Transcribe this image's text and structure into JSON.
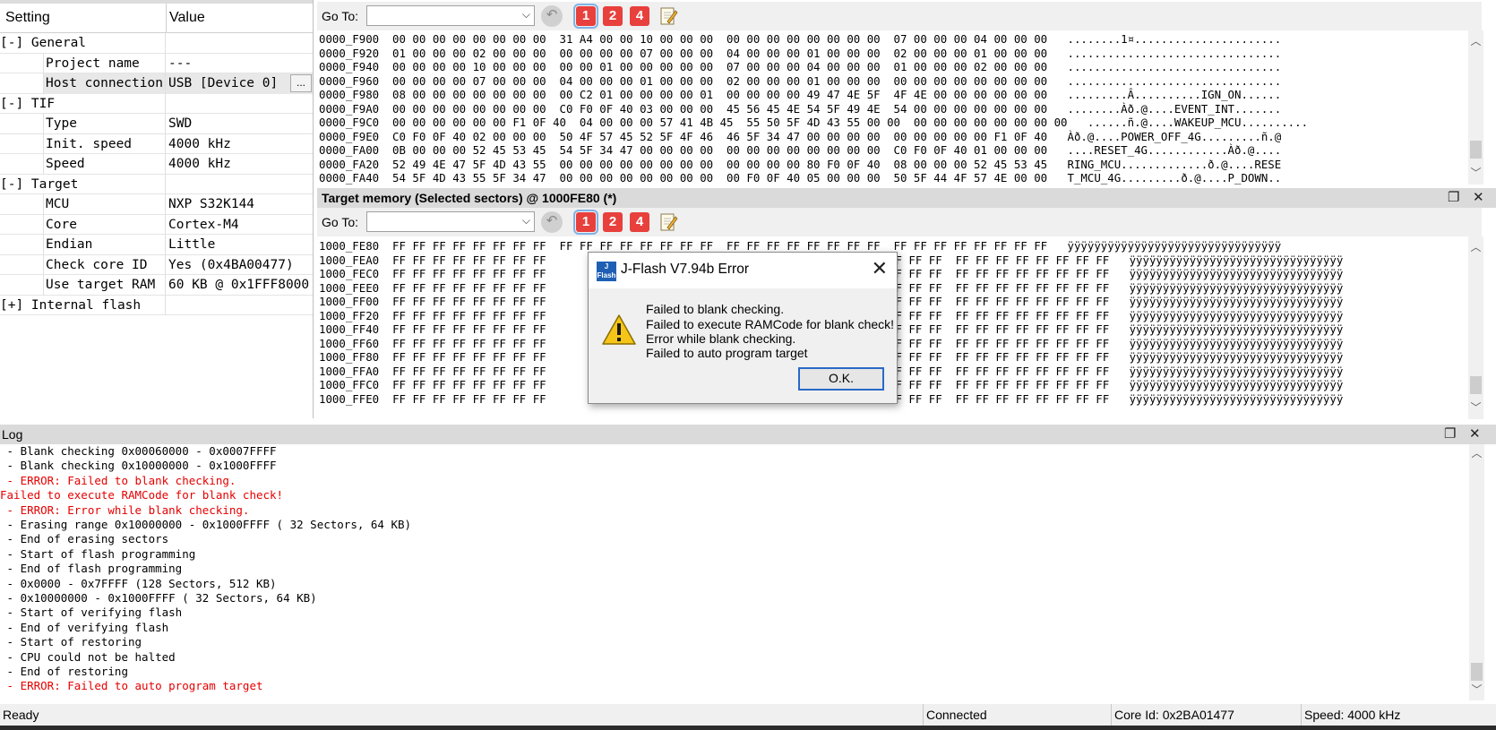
{
  "settings": {
    "header_setting": "Setting",
    "header_value": "Value",
    "rows": [
      {
        "setting": "[-] General",
        "value": ""
      },
      {
        "setting": "Project name",
        "value": "---"
      },
      {
        "setting": "Host connection",
        "value": "USB [Device 0]",
        "browse": "..."
      },
      {
        "setting": "[-] TIF",
        "value": ""
      },
      {
        "setting": "Type",
        "value": "SWD"
      },
      {
        "setting": "Init. speed",
        "value": "4000 kHz"
      },
      {
        "setting": "Speed",
        "value": "4000 kHz"
      },
      {
        "setting": "[-] Target",
        "value": ""
      },
      {
        "setting": "MCU",
        "value": "NXP S32K144"
      },
      {
        "setting": "Core",
        "value": "Cortex-M4"
      },
      {
        "setting": "Endian",
        "value": "Little"
      },
      {
        "setting": "Check core ID",
        "value": "Yes (0x4BA00477)"
      },
      {
        "setting": "Use target RAM",
        "value": "60 KB @ 0x1FFF8000"
      },
      {
        "setting": "[+] Internal flash",
        "value": ""
      }
    ]
  },
  "toolbar": {
    "goto_label": "Go To:",
    "buttons": [
      "1",
      "2",
      "4"
    ]
  },
  "hex_top": {
    "lines": [
      "0000_F900  00 00 00 00 00 00 00 00  31 A4 00 00 10 00 00 00  00 00 00 00 00 00 00 00  07 00 00 00 04 00 00 00   ........1¤......................",
      "0000_F920  01 00 00 00 02 00 00 00  00 00 00 00 07 00 00 00  04 00 00 00 01 00 00 00  02 00 00 00 01 00 00 00   ................................",
      "0000_F940  00 00 00 00 10 00 00 00  00 00 01 00 00 00 00 00  07 00 00 00 04 00 00 00  01 00 00 00 02 00 00 00   ................................",
      "0000_F960  00 00 00 00 07 00 00 00  04 00 00 00 01 00 00 00  02 00 00 00 01 00 00 00  00 00 00 00 00 00 00 00   ................................",
      "0000_F980  08 00 00 00 00 00 00 00  00 C2 01 00 00 00 00 01  00 00 00 00 49 47 4E 5F  4F 4E 00 00 00 00 00 00   .........Â..........IGN_ON......",
      "0000_F9A0  00 00 00 00 00 00 00 00  C0 F0 0F 40 03 00 00 00  45 56 45 4E 54 5F 49 4E  54 00 00 00 00 00 00 00   ........Àð.@....EVENT_INT.......",
      "0000_F9C0  00 00 00 00 00 00 F1 0F 40  04 00 00 00 57 41 4B 45  55 50 5F 4D 43 55 00 00  00 00 00 00 00 00 00 00   ......ñ.@....WAKEUP_MCU..........",
      "0000_F9E0  C0 F0 0F 40 02 00 00 00  50 4F 57 45 52 5F 4F 46  46 5F 34 47 00 00 00 00  00 00 00 00 00 F1 0F 40   Àð.@....POWER_OFF_4G.........ñ.@",
      "0000_FA00  0B 00 00 00 52 45 53 45  54 5F 34 47 00 00 00 00  00 00 00 00 00 00 00 00  C0 F0 0F 40 01 00 00 00   ....RESET_4G............Àð.@....",
      "0000_FA20  52 49 4E 47 5F 4D 43 55  00 00 00 00 00 00 00 00  00 00 00 00 80 F0 0F 40  08 00 00 00 52 45 53 45   RING_MCU.............ð.@....RESE",
      "0000_FA40  54 5F 4D 43 55 5F 34 47  00 00 00 00 00 00 00 00  00 F0 0F 40 05 00 00 00  50 5F 44 4F 57 4E 00 00   T_MCU_4G.........ð.@....P_DOWN.."
    ]
  },
  "target_memory": {
    "title": "Target memory (Selected sectors) @ 1000FE80 (*)",
    "addresses": [
      "1000_FE80",
      "1000_FEA0",
      "1000_FEC0",
      "1000_FEE0",
      "1000_FF00",
      "1000_FF20",
      "1000_FF40",
      "1000_FF60",
      "1000_FF80",
      "1000_FFA0",
      "1000_FFC0",
      "1000_FFE0"
    ],
    "bytes_left": "FF FF FF FF FF FF FF FF",
    "line_first": "  FF FF FF FF FF FF FF FF  FF FF FF FF FF FF FF FF  FF FF FF FF FF FF FF FF  FF FF FF FF FF FF FF FF   ÿÿÿÿÿÿÿÿÿÿÿÿÿÿÿÿÿÿÿÿÿÿÿÿÿÿÿÿÿÿÿÿ",
    "line_right": "FF FF FF FF  FF FF FF FF FF FF FF FF   ÿÿÿÿÿÿÿÿÿÿÿÿÿÿÿÿÿÿÿÿÿÿÿÿÿÿÿÿÿÿÿÿ"
  },
  "log": {
    "title": "Log",
    "lines": [
      {
        "text": " - Blank checking 0x00060000 - 0x0007FFFF",
        "error": false
      },
      {
        "text": " - Blank checking 0x10000000 - 0x1000FFFF",
        "error": false
      },
      {
        "text": " - ERROR: Failed to blank checking.",
        "error": true
      },
      {
        "text": "Failed to execute RAMCode for blank check!",
        "error": true
      },
      {
        "text": " - ERROR: Error while blank checking.",
        "error": true
      },
      {
        "text": " - Erasing range 0x10000000 - 0x1000FFFF ( 32 Sectors, 64 KB)",
        "error": false
      },
      {
        "text": " - End of erasing sectors",
        "error": false
      },
      {
        "text": " - Start of flash programming",
        "error": false
      },
      {
        "text": " - End of flash programming",
        "error": false
      },
      {
        "text": " - 0x0000 - 0x7FFFF (128 Sectors, 512 KB)",
        "error": false
      },
      {
        "text": " - 0x10000000 - 0x1000FFFF ( 32 Sectors, 64 KB)",
        "error": false
      },
      {
        "text": " - Start of verifying flash",
        "error": false
      },
      {
        "text": " - End of verifying flash",
        "error": false
      },
      {
        "text": " - Start of restoring",
        "error": false
      },
      {
        "text": " - CPU could not be halted",
        "error": false
      },
      {
        "text": " - End of restoring",
        "error": false
      },
      {
        "text": " - ERROR: Failed to auto program target",
        "error": true
      }
    ]
  },
  "status": {
    "ready": "Ready",
    "connected": "Connected",
    "core_id": "Core Id: 0x2BA01477",
    "speed": "Speed: 4000 kHz"
  },
  "dialog": {
    "title": "J-Flash V7.94b Error",
    "icon_text": "J Flash",
    "messages": [
      "Failed to blank checking.",
      "Failed to execute RAMCode for blank check!",
      "Error while blank checking.",
      "Failed to auto program target"
    ],
    "ok_label": "O.K."
  },
  "colors": {
    "error_text": "#e60000",
    "toolbar_number": "#e8403c",
    "dialog_accent": "#2a68c8"
  }
}
